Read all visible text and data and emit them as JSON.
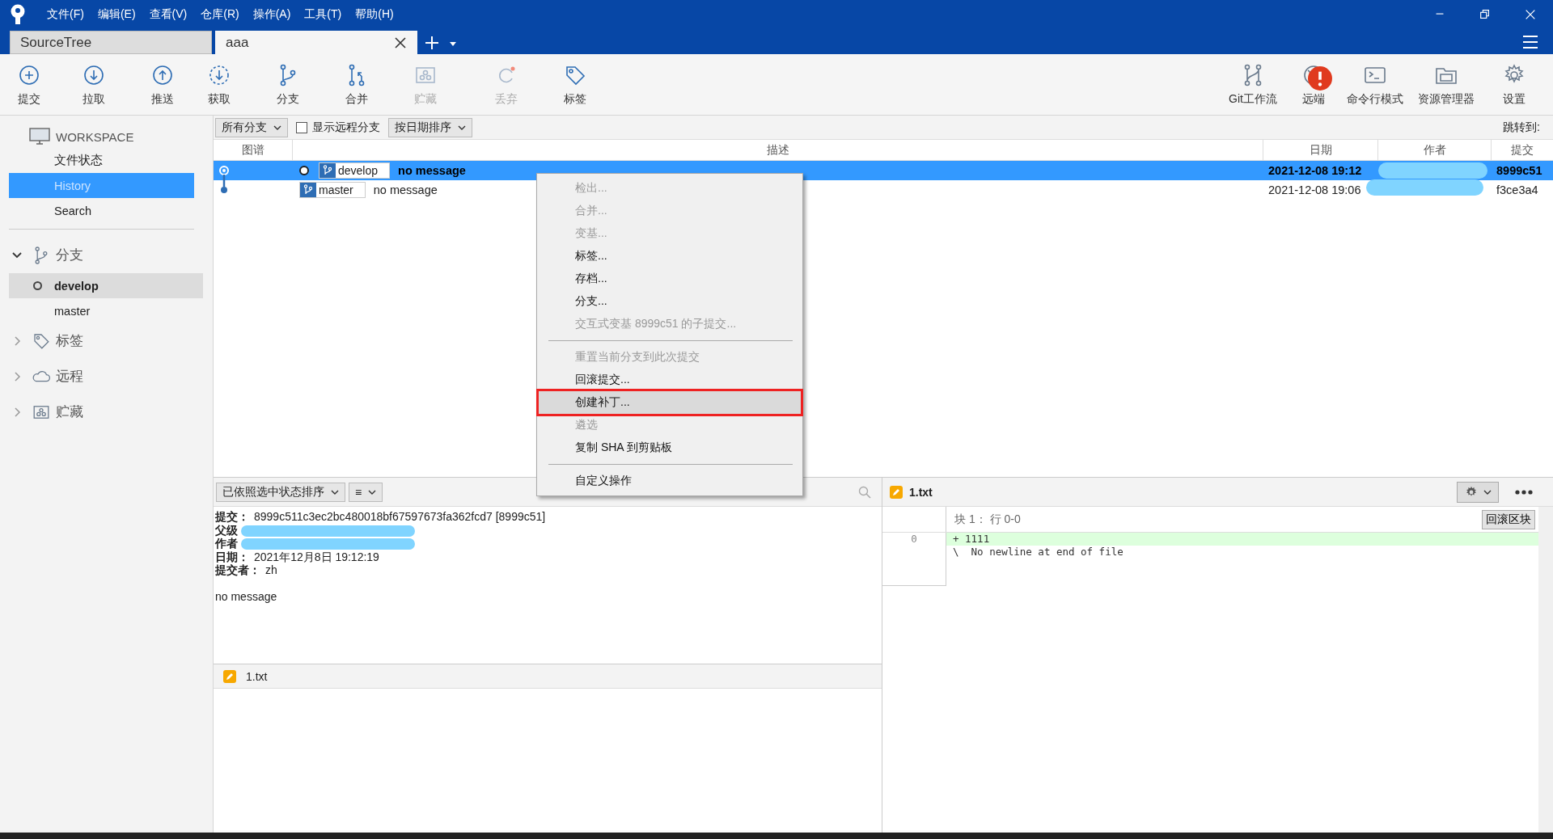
{
  "menubar": {
    "items": [
      "文件(F)",
      "编辑(E)",
      "查看(V)",
      "仓库(R)",
      "操作(A)",
      "工具(T)",
      "帮助(H)"
    ]
  },
  "tabs": [
    {
      "label": "SourceTree",
      "selected": false,
      "closable": false
    },
    {
      "label": "aaa",
      "selected": true,
      "closable": true
    }
  ],
  "toolbar": {
    "left": [
      {
        "label": "提交",
        "kind": "commit",
        "disabled": false
      },
      {
        "label": "拉取",
        "kind": "pull",
        "disabled": false
      },
      {
        "label": "推送",
        "kind": "push",
        "disabled": false
      },
      {
        "label": "获取",
        "kind": "fetch",
        "disabled": false
      },
      {
        "label": "分支",
        "kind": "branch",
        "disabled": false
      },
      {
        "label": "合并",
        "kind": "merge",
        "disabled": false
      },
      {
        "label": "贮藏",
        "kind": "stash",
        "disabled": true
      },
      {
        "label": "丢弃",
        "kind": "discard",
        "disabled": true
      },
      {
        "label": "标签",
        "kind": "tag",
        "disabled": false
      }
    ],
    "right": [
      {
        "label": "Git工作流",
        "kind": "gitflow",
        "disabled": false,
        "alert": false
      },
      {
        "label": "远端",
        "kind": "remote",
        "disabled": false,
        "alert": true
      },
      {
        "label": "命令行模式",
        "kind": "terminal",
        "disabled": false,
        "alert": false
      },
      {
        "label": "资源管理器",
        "kind": "explorer",
        "disabled": false,
        "alert": false
      },
      {
        "label": "设置",
        "kind": "settings",
        "disabled": false,
        "alert": false
      }
    ]
  },
  "sidebar": {
    "workspace": "WORKSPACE",
    "items": [
      {
        "label": "文件状态",
        "selected": false
      },
      {
        "label": "History",
        "selected": true
      },
      {
        "label": "Search",
        "selected": false
      }
    ],
    "sections": [
      {
        "label": "分支",
        "kind": "branch",
        "expanded": true,
        "children": [
          {
            "label": "develop",
            "current": true,
            "selected": true
          },
          {
            "label": "master",
            "current": false,
            "selected": false
          }
        ]
      },
      {
        "label": "标签",
        "kind": "tag",
        "expanded": false
      },
      {
        "label": "远程",
        "kind": "cloud",
        "expanded": false
      },
      {
        "label": "贮藏",
        "kind": "stash",
        "expanded": false
      }
    ]
  },
  "history": {
    "branch_filter": "所有分支",
    "show_remote": {
      "label": "显示远程分支",
      "checked": false
    },
    "sort": "按日期排序",
    "jump_to": "跳转到:",
    "columns": [
      "图谱",
      "描述",
      "日期",
      "作者",
      "提交"
    ],
    "commits": [
      {
        "branch": "develop",
        "head": true,
        "message": "no message",
        "date": "2021-12-08 19:12",
        "hash": "8999c51",
        "selected": true,
        "author_redacted": true
      },
      {
        "branch": "master",
        "head": false,
        "message": "no message",
        "date": "2021-12-08 19:06",
        "hash": "f3ce3a4",
        "selected": false,
        "author_redacted": true
      }
    ]
  },
  "context_menu": [
    {
      "kind": "item",
      "label": "检出...",
      "disabled": true,
      "highlighted": false
    },
    {
      "kind": "item",
      "label": "合并...",
      "disabled": true,
      "highlighted": false
    },
    {
      "kind": "item",
      "label": "变基...",
      "disabled": true,
      "highlighted": false
    },
    {
      "kind": "item",
      "label": "标签...",
      "disabled": false,
      "highlighted": false
    },
    {
      "kind": "item",
      "label": "存档...",
      "disabled": false,
      "highlighted": false
    },
    {
      "kind": "item",
      "label": "分支...",
      "disabled": false,
      "highlighted": false
    },
    {
      "kind": "item",
      "label": "交互式变基 8999c51 的子提交...",
      "disabled": true,
      "highlighted": false
    },
    {
      "kind": "separator"
    },
    {
      "kind": "item",
      "label": "重置当前分支到此次提交",
      "disabled": true,
      "highlighted": false
    },
    {
      "kind": "item",
      "label": "回滚提交...",
      "disabled": false,
      "highlighted": false
    },
    {
      "kind": "item",
      "label": "创建补丁...",
      "disabled": false,
      "highlighted": true
    },
    {
      "kind": "item",
      "label": "遴选",
      "disabled": true,
      "highlighted": false
    },
    {
      "kind": "item",
      "label": "复制 SHA 到剪贴板",
      "disabled": false,
      "highlighted": false
    },
    {
      "kind": "separator"
    },
    {
      "kind": "item",
      "label": "自定义操作",
      "disabled": false,
      "highlighted": false
    }
  ],
  "details": {
    "sort": "已依照选中状态排序",
    "view_menu": "≡",
    "lines": [
      {
        "label": "提交：",
        "value": "8999c511c3ec2bc480018bf67597673fa362fcd7 [8999c51]",
        "redacted": false
      },
      {
        "label": "父级",
        "redacted": true
      },
      {
        "label": "作者",
        "redacted": true
      },
      {
        "label": "日期：",
        "value": "2021年12月8日 19:12:19",
        "redacted": false
      },
      {
        "label": "提交者：",
        "value": "zh",
        "redacted": false
      }
    ],
    "message": "no message",
    "files": [
      {
        "name": "1.txt"
      }
    ]
  },
  "diff": {
    "file": "1.txt",
    "hunk": "块 1： 行 0-0",
    "revert_button": "回滚区块",
    "lines": [
      {
        "number": "0",
        "text": "+ 1111",
        "kind": "added"
      },
      {
        "text": "\\  No newline at end of file",
        "kind": "info"
      }
    ]
  }
}
